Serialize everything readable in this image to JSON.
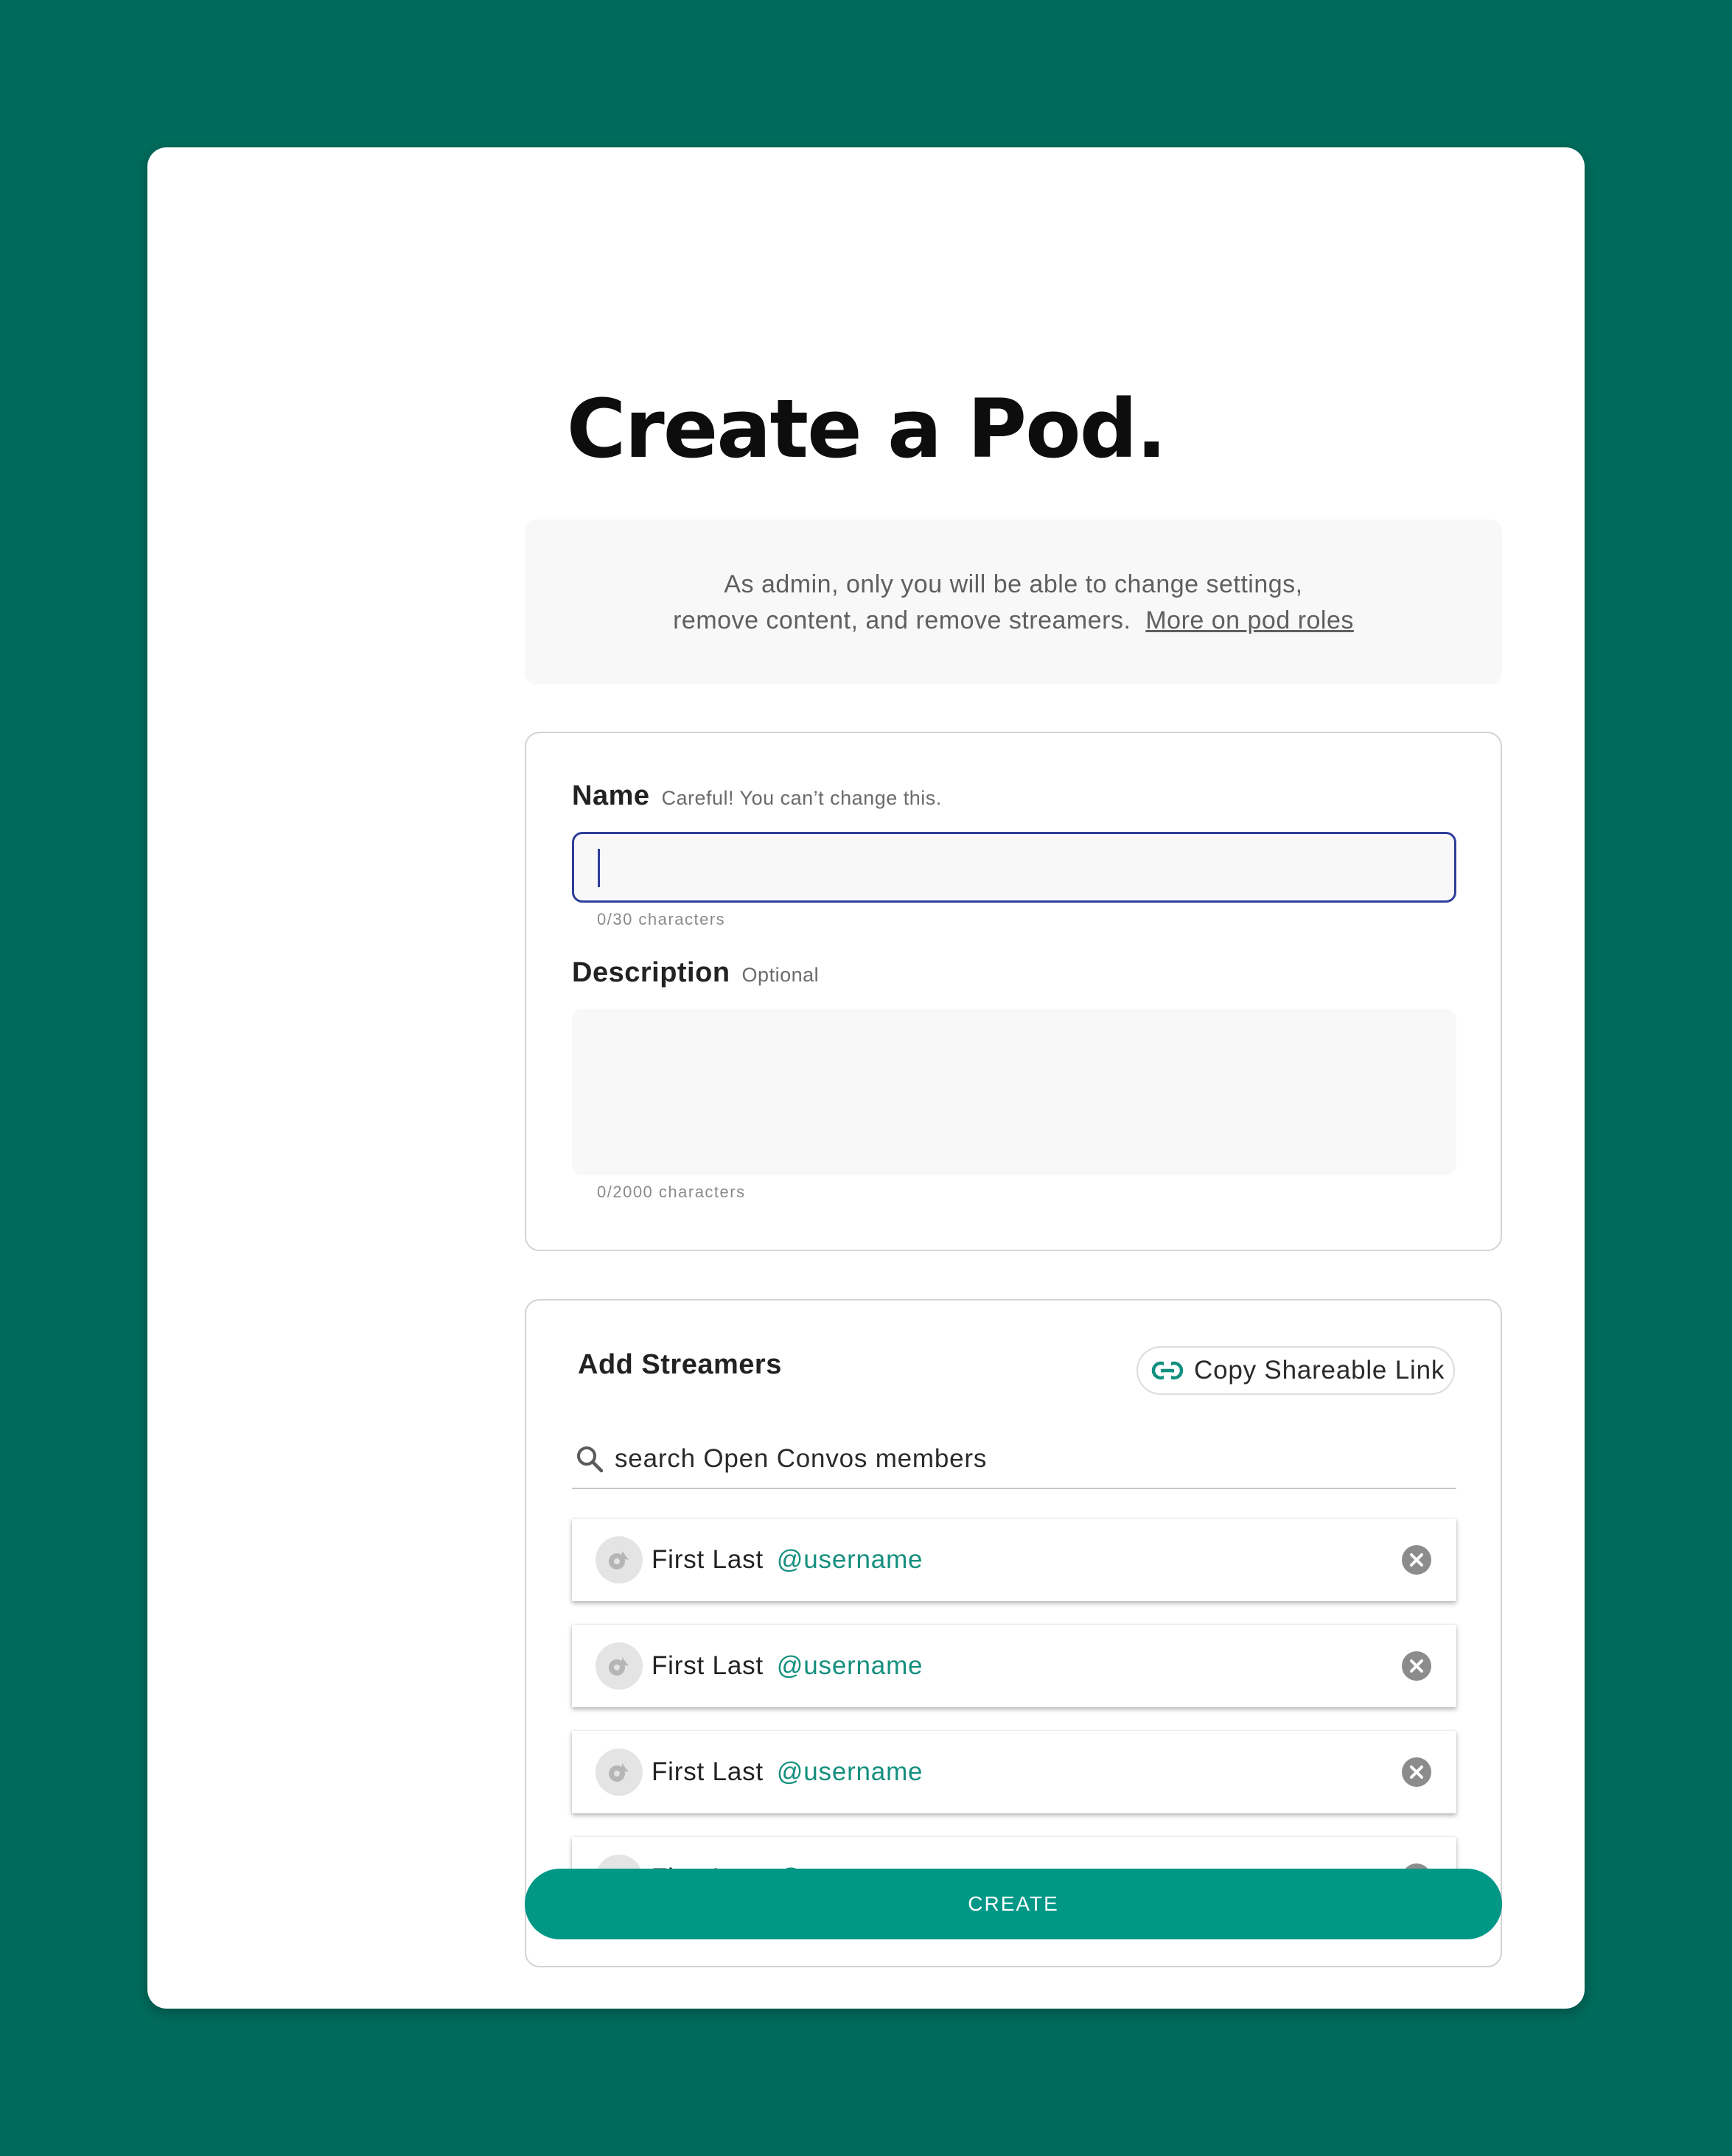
{
  "page": {
    "title": "Create a Pod.",
    "colors": {
      "background": "#006b5c",
      "accent": "#009787",
      "username": "#158f7e",
      "focus": "#2f3f9a"
    }
  },
  "info": {
    "line1": "As admin, only you will be able to change settings,",
    "line2": "remove content, and remove streamers.",
    "link_label": "More on pod roles"
  },
  "form": {
    "name": {
      "label": "Name",
      "hint": "Careful! You can’t change this.",
      "value": "",
      "counter": "0/30 characters"
    },
    "description": {
      "label": "Description",
      "hint": "Optional",
      "value": "",
      "counter": "0/2000 characters"
    }
  },
  "streamers": {
    "title": "Add Streamers",
    "copy_link_label": "Copy Shareable Link",
    "copy_link_icon": "link-icon",
    "search_placeholder": "search Open Convos members",
    "search_icon": "search-icon",
    "members": [
      {
        "name": "First Last",
        "username": "@username"
      },
      {
        "name": "First Last",
        "username": "@username"
      },
      {
        "name": "First Last",
        "username": "@username"
      },
      {
        "name": "First Last",
        "username": "@username"
      }
    ]
  },
  "actions": {
    "create_label": "CREATE"
  }
}
